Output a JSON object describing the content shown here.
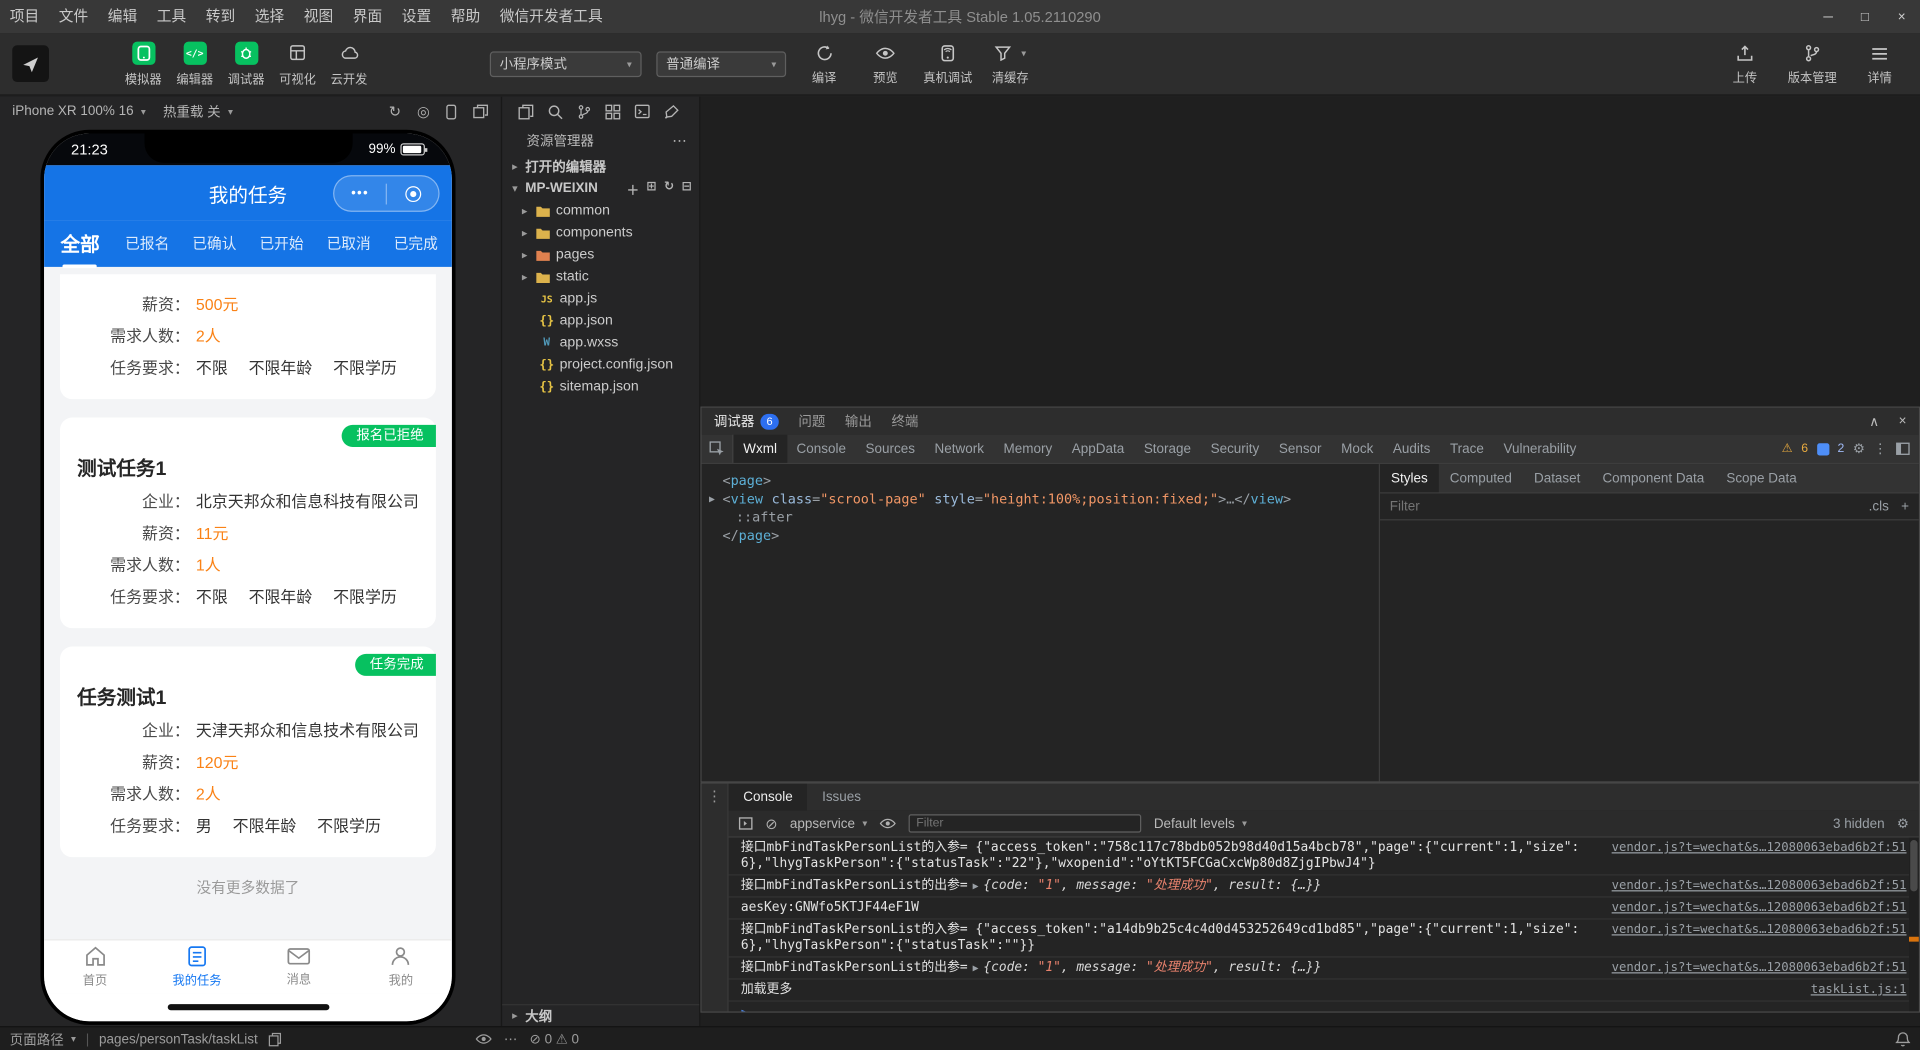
{
  "icons": {
    "caret_down": "▾",
    "chevron_right": "▸",
    "chevron_down": "▾",
    "more_dots": "•••",
    "more_h": "⋯",
    "more_v": "⋮",
    "refresh": "↻",
    "record": "◎",
    "plus": "＋",
    "new_folder": "⊞",
    "collapse_all": "⊟",
    "minimize": "─",
    "maximize": "□",
    "close": "×",
    "collapse_up": "∧",
    "gear": "⚙",
    "warning": "⚠",
    "circle_slash": "⊘",
    "triangle_right": "▶",
    "prompt": ">",
    "js_badge": "JS",
    "json_braces": "{}",
    "wxss_badge": "W",
    "code_glyph": "</>"
  },
  "titlebar": {
    "menus": [
      "项目",
      "文件",
      "编辑",
      "工具",
      "转到",
      "选择",
      "视图",
      "界面",
      "设置",
      "帮助",
      "微信开发者工具"
    ],
    "title": "lhyg - 微信开发者工具 Stable 1.05.2110290"
  },
  "toolbar": {
    "tools": [
      {
        "label": "模拟器"
      },
      {
        "label": "编辑器"
      },
      {
        "label": "调试器"
      },
      {
        "label": "可视化"
      },
      {
        "label": "云开发"
      }
    ],
    "mode_select": "小程序模式",
    "compile_select": "普通编译",
    "compile": "编译",
    "preview": "预览",
    "remote_debug": "真机调试",
    "clear_cache": "清缓存",
    "upload": "上传",
    "version": "版本管理",
    "details": "详情"
  },
  "simulator": {
    "device": "iPhone XR 100% 16",
    "hot_reload": "热重载 关",
    "time": "21:23",
    "battery": "99%",
    "nav_title": "我的任务",
    "tabs": [
      "全部",
      "已报名",
      "已确认",
      "已开始",
      "已取消",
      "已完成"
    ],
    "labels": {
      "company": "企业：",
      "salary": "薪资：",
      "people": "需求人数：",
      "requirement": "任务要求："
    },
    "cards": [
      {
        "salary": "500元",
        "people": "2人",
        "reqs": [
          "不限",
          "不限年龄",
          "不限学历"
        ]
      },
      {
        "badge": "报名已拒绝",
        "title": "测试任务1",
        "company": "北京天邦众和信息科技有限公司",
        "salary": "11元",
        "people": "1人",
        "reqs": [
          "不限",
          "不限年龄",
          "不限学历"
        ]
      },
      {
        "badge": "任务完成",
        "title": "任务测试1",
        "company": "天津天邦众和信息技术有限公司",
        "salary": "120元",
        "people": "2人",
        "reqs": [
          "男",
          "不限年龄",
          "不限学历"
        ]
      }
    ],
    "empty_text": "没有更多数据了",
    "tabbar": [
      {
        "label": "首页"
      },
      {
        "label": "我的任务"
      },
      {
        "label": "消息"
      },
      {
        "label": "我的"
      }
    ]
  },
  "explorer": {
    "title": "资源管理器",
    "open_editors": "打开的编辑器",
    "project": "MP-WEIXIN",
    "folders": [
      "common",
      "components",
      "pages",
      "static"
    ],
    "files": [
      "app.js",
      "app.json",
      "app.wxss",
      "project.config.json",
      "sitemap.json"
    ],
    "outline": "大纲"
  },
  "debugger": {
    "window_tabs": [
      "调试器",
      "问题",
      "输出",
      "终端"
    ],
    "badge": "6",
    "tabs": [
      "Wxml",
      "Console",
      "Sources",
      "Network",
      "Memory",
      "AppData",
      "Storage",
      "Security",
      "Sensor",
      "Mock",
      "Audits",
      "Trace",
      "Vulnerability"
    ],
    "warn_count": "6",
    "info_count": "2",
    "wxml": {
      "lt": "<",
      "gt": ">",
      "close_lt": "</",
      "eq": "=",
      "tag_page": "page",
      "tag_view": "view",
      "attr_class": "class",
      "val_class": "\"scrool-page\"",
      "attr_style": "style",
      "val_style": "\"height:100%;position:fixed;\"",
      "collapsed": ">…</",
      "after": "::after"
    },
    "styles_tabs": [
      "Styles",
      "Computed",
      "Dataset",
      "Component Data",
      "Scope Data"
    ],
    "filter_placeholder": "Filter",
    "cls_label": ".cls",
    "add_label": "+"
  },
  "console": {
    "tabs": [
      "Console",
      "Issues"
    ],
    "context": "appservice",
    "filter_placeholder": "Filter",
    "levels": "Default levels",
    "hidden": "3 hidden",
    "logs": [
      {
        "text": "接口mbFindTaskPersonList的入参= {\"access_token\":\"758c117c78bdb052b98d40d15a4bcb78\",\"page\":{\"current\":1,\"size\":6},\"lhygTaskPerson\":{\"statusTask\":\"22\"},\"wxopenid\":\"oYtKT5FCGaCxcWp80d8ZjgIPbwJ4\"}",
        "source": "vendor.js?t=wechat&s…12080063ebad6b2f:51"
      },
      {
        "prefix": "接口mbFindTaskPersonList的出参=",
        "source": "vendor.js?t=wechat&s…12080063ebad6b2f:51"
      },
      {
        "text": "aesKey:GNWfo5KTJF44eF1W",
        "source": "vendor.js?t=wechat&s…12080063ebad6b2f:51"
      },
      {
        "text": "接口mbFindTaskPersonList的入参= {\"access_token\":\"a14db9b25c4c4d0d453252649cd1bd85\",\"page\":{\"current\":1,\"size\":6},\"lhygTaskPerson\":{\"statusTask\":\"\"}}",
        "source": "vendor.js?t=wechat&s…12080063ebad6b2f:51"
      },
      {
        "prefix": "接口mbFindTaskPersonList的出参=",
        "source": "vendor.js?t=wechat&s…12080063ebad6b2f:51"
      },
      {
        "text": "加载更多",
        "source": "taskList.js:1"
      }
    ],
    "obj": {
      "o": "{",
      "k1": "code: ",
      "v1": "\"1\"",
      "s1": ", ",
      "k2": "message: ",
      "v2": "\"处理成功\"",
      "s2": ", ",
      "k3": "result: ",
      "v3": "{…}",
      "c": "}"
    }
  },
  "statusbar": {
    "path_label": "页面路径",
    "path": "pages/personTask/taskList",
    "errors": "0",
    "warnings": "0"
  }
}
